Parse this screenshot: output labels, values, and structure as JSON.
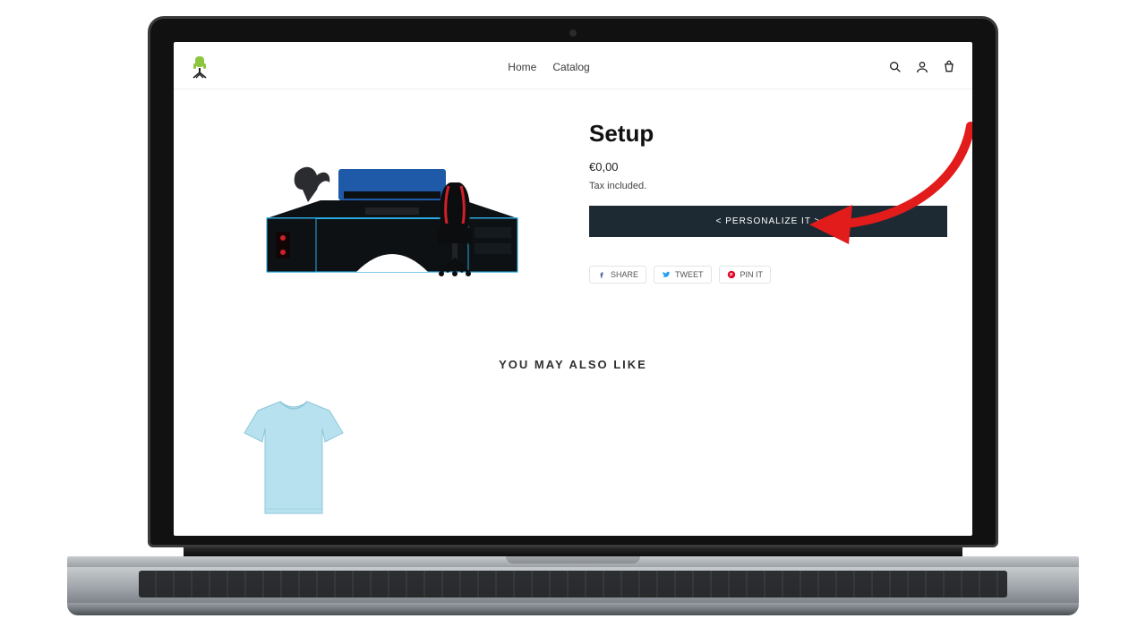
{
  "header": {
    "nav": {
      "home": "Home",
      "catalog": "Catalog"
    }
  },
  "product": {
    "title": "Setup",
    "price": "€0,00",
    "tax_note": "Tax included.",
    "personalize_label": "< PERSONALIZE IT >"
  },
  "share": {
    "facebook": "SHARE",
    "twitter": "TWEET",
    "pinterest": "PIN IT"
  },
  "recommendations": {
    "heading": "YOU MAY ALSO LIKE"
  },
  "colors": {
    "button_bg": "#1e2a33",
    "arrow": "#e21b1b",
    "logo_green": "#8cc63f"
  }
}
